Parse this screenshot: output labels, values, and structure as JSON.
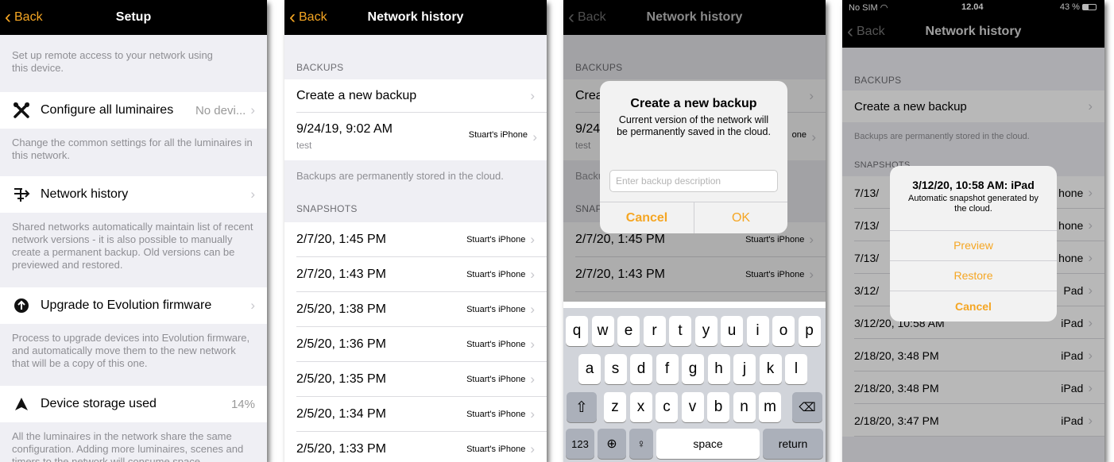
{
  "screen1": {
    "back": "Back",
    "title": "Setup",
    "intro": "Set up remote access to your network using this device.",
    "items": [
      {
        "label": "Configure all luminaires",
        "value": "No devi...",
        "desc": "Change the common settings for all the luminaires in this network.",
        "icon": "wrench-screwdriver-icon"
      },
      {
        "label": "Network history",
        "value": "",
        "desc": "Shared networks automatically maintain list of recent network versions - it is also possible to manually create a permanent backup. Old versions can be previewed and restored.",
        "icon": "network-history-icon"
      },
      {
        "label": "Upgrade to Evolution firmware",
        "value": "",
        "desc": "Process to upgrade devices into Evolution firmware, and automatically move them to the new network that will be a copy of this one.",
        "icon": "upgrade-arrow-icon"
      },
      {
        "label": "Device storage used",
        "value": "14%",
        "desc": "All the luminaires in the network share the same configuration. Adding more luminaires, scenes and timers to the network will consume space.",
        "icon": "storage-triangle-icon"
      }
    ]
  },
  "screen2": {
    "back": "Back",
    "title": "Network history",
    "backups_header": "BACKUPS",
    "create": "Create a new backup",
    "backup_row": {
      "date": "9/24/19, 9:02 AM",
      "note": "test",
      "device": "Stuart's iPhone"
    },
    "backups_note": "Backups are permanently stored in the cloud.",
    "snapshots_header": "SNAPSHOTS",
    "snapshots": [
      {
        "date": "2/7/20, 1:45 PM",
        "device": "Stuart's iPhone"
      },
      {
        "date": "2/7/20, 1:43 PM",
        "device": "Stuart's iPhone"
      },
      {
        "date": "2/5/20, 1:38 PM",
        "device": "Stuart's iPhone"
      },
      {
        "date": "2/5/20, 1:36 PM",
        "device": "Stuart's iPhone"
      },
      {
        "date": "2/5/20, 1:35 PM",
        "device": "Stuart's iPhone"
      },
      {
        "date": "2/5/20, 1:34 PM",
        "device": "Stuart's iPhone"
      },
      {
        "date": "2/5/20, 1:33 PM",
        "device": "Stuart's iPhone"
      }
    ]
  },
  "screen3": {
    "back": "Back",
    "title": "Network history",
    "backups_header": "BACKUPS",
    "create_partial": "Crea",
    "backup_partial": "9/24",
    "backup_note_partial": "test",
    "backup_device_partial": "one",
    "backups_note_partial": "Backu",
    "snapshots_partial": "SNAP",
    "snapshots": [
      {
        "date": "2/7/20, 1:45 PM",
        "device": "Stuart's iPhone"
      },
      {
        "date": "2/7/20, 1:43 PM",
        "device": "Stuart's iPhone"
      }
    ],
    "alert": {
      "title": "Create a new backup",
      "message": "Current version of the network will be permanently saved in the cloud.",
      "placeholder": "Enter backup description",
      "cancel": "Cancel",
      "ok": "OK"
    },
    "keyboard": {
      "row1": [
        "q",
        "w",
        "e",
        "r",
        "t",
        "y",
        "u",
        "i",
        "o",
        "p"
      ],
      "row2": [
        "a",
        "s",
        "d",
        "f",
        "g",
        "h",
        "j",
        "k",
        "l"
      ],
      "row3": [
        "z",
        "x",
        "c",
        "v",
        "b",
        "n",
        "m"
      ],
      "num": "123",
      "space": "space",
      "return": "return"
    }
  },
  "screen4": {
    "status": {
      "carrier": "No SIM",
      "time": "12.04",
      "battery": "43 %"
    },
    "back": "Back",
    "title": "Network history",
    "backups_header": "BACKUPS",
    "create": "Create a new backup",
    "backups_note": "Backups are permanently stored in the cloud.",
    "snapshots_partial": "SNAPSHOTS",
    "rows": [
      {
        "date": "7/13/",
        "device": "hone"
      },
      {
        "date": "7/13/",
        "device": "hone"
      },
      {
        "date": "7/13/",
        "device": "hone"
      },
      {
        "date": "3/12/",
        "device": "Pad"
      },
      {
        "date": "3/12/20, 10:58 AM",
        "device": "iPad"
      },
      {
        "date": "2/18/20, 3:48 PM",
        "device": "iPad"
      },
      {
        "date": "2/18/20, 3:48 PM",
        "device": "iPad"
      },
      {
        "date": "2/18/20, 3:47 PM",
        "device": "iPad"
      }
    ],
    "sheet": {
      "title": "3/12/20, 10:58 AM: iPad",
      "message": "Automatic snapshot generated by the cloud.",
      "preview": "Preview",
      "restore": "Restore",
      "cancel": "Cancel"
    }
  },
  "colors": {
    "accent": "#f5a623",
    "navbar": "#000000",
    "background": "#efeff4"
  }
}
